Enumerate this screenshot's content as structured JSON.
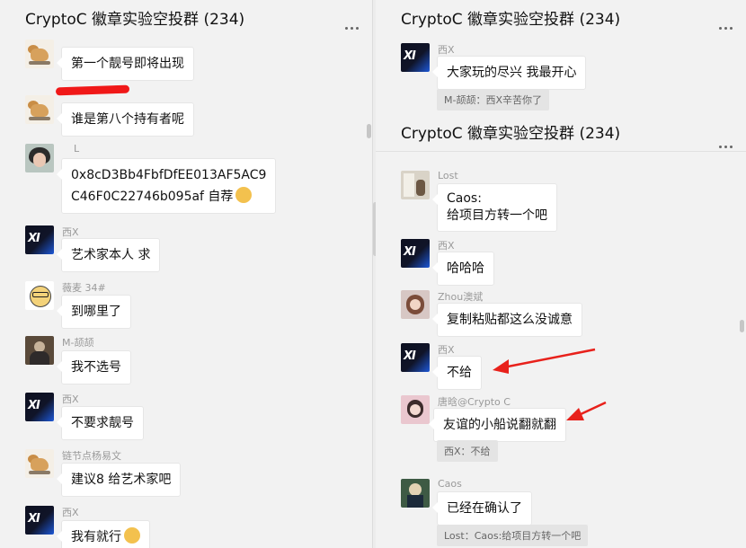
{
  "left": {
    "title": "CryptoC 徽章实验空投群 (234)",
    "messages": [
      {
        "nick": "",
        "text": "第一个靓号即将出现"
      },
      {
        "nick": "",
        "text": "谁是第八个持有者呢"
      },
      {
        "nick": "L",
        "text_line1": "0x8cD3Bb4FbfDfEE013AF5AC9",
        "text_line2": "C46F0C22746b095af 自荐"
      },
      {
        "nick": "西X",
        "text": "艺术家本人 求"
      },
      {
        "nick": "薇麦 34#",
        "text": "到哪里了"
      },
      {
        "nick": "M-颉颉",
        "text": "我不选号"
      },
      {
        "nick": "西X",
        "text": "不要求靓号"
      },
      {
        "nick": "链节点杨易文",
        "text": "建议8 给艺术家吧"
      },
      {
        "nick": "西X",
        "text": "我有就行"
      }
    ]
  },
  "right_top": {
    "title": "CryptoC 徽章实验空投群 (234)",
    "messages": [
      {
        "nick": "西X",
        "text": "大家玩的尽兴 我最开心",
        "quote": "M-颉颉：西X辛苦你了"
      }
    ]
  },
  "right_bottom": {
    "title": "CryptoC 徽章实验空投群 (234)",
    "messages": [
      {
        "nick": "Lost",
        "text_line1": "Caos:",
        "text_line2": "给项目方转一个吧"
      },
      {
        "nick": "西X",
        "text": "哈哈哈"
      },
      {
        "nick": "Zhou澳斌",
        "text": "复制粘贴都这么没诚意"
      },
      {
        "nick": "西X",
        "text": "不给"
      },
      {
        "nick": "唐晗@Crypto C",
        "text": "友谊的小船说翻就翻",
        "quote": "西X：不给"
      },
      {
        "nick": "Caos",
        "text": "已经在确认了",
        "quote": "Lost：Caos:给项目方转一个吧"
      }
    ]
  },
  "colors": {
    "annotation_arrow": "#e8211b",
    "bubble": "#ffffff",
    "pane": "#f2f2f2"
  }
}
